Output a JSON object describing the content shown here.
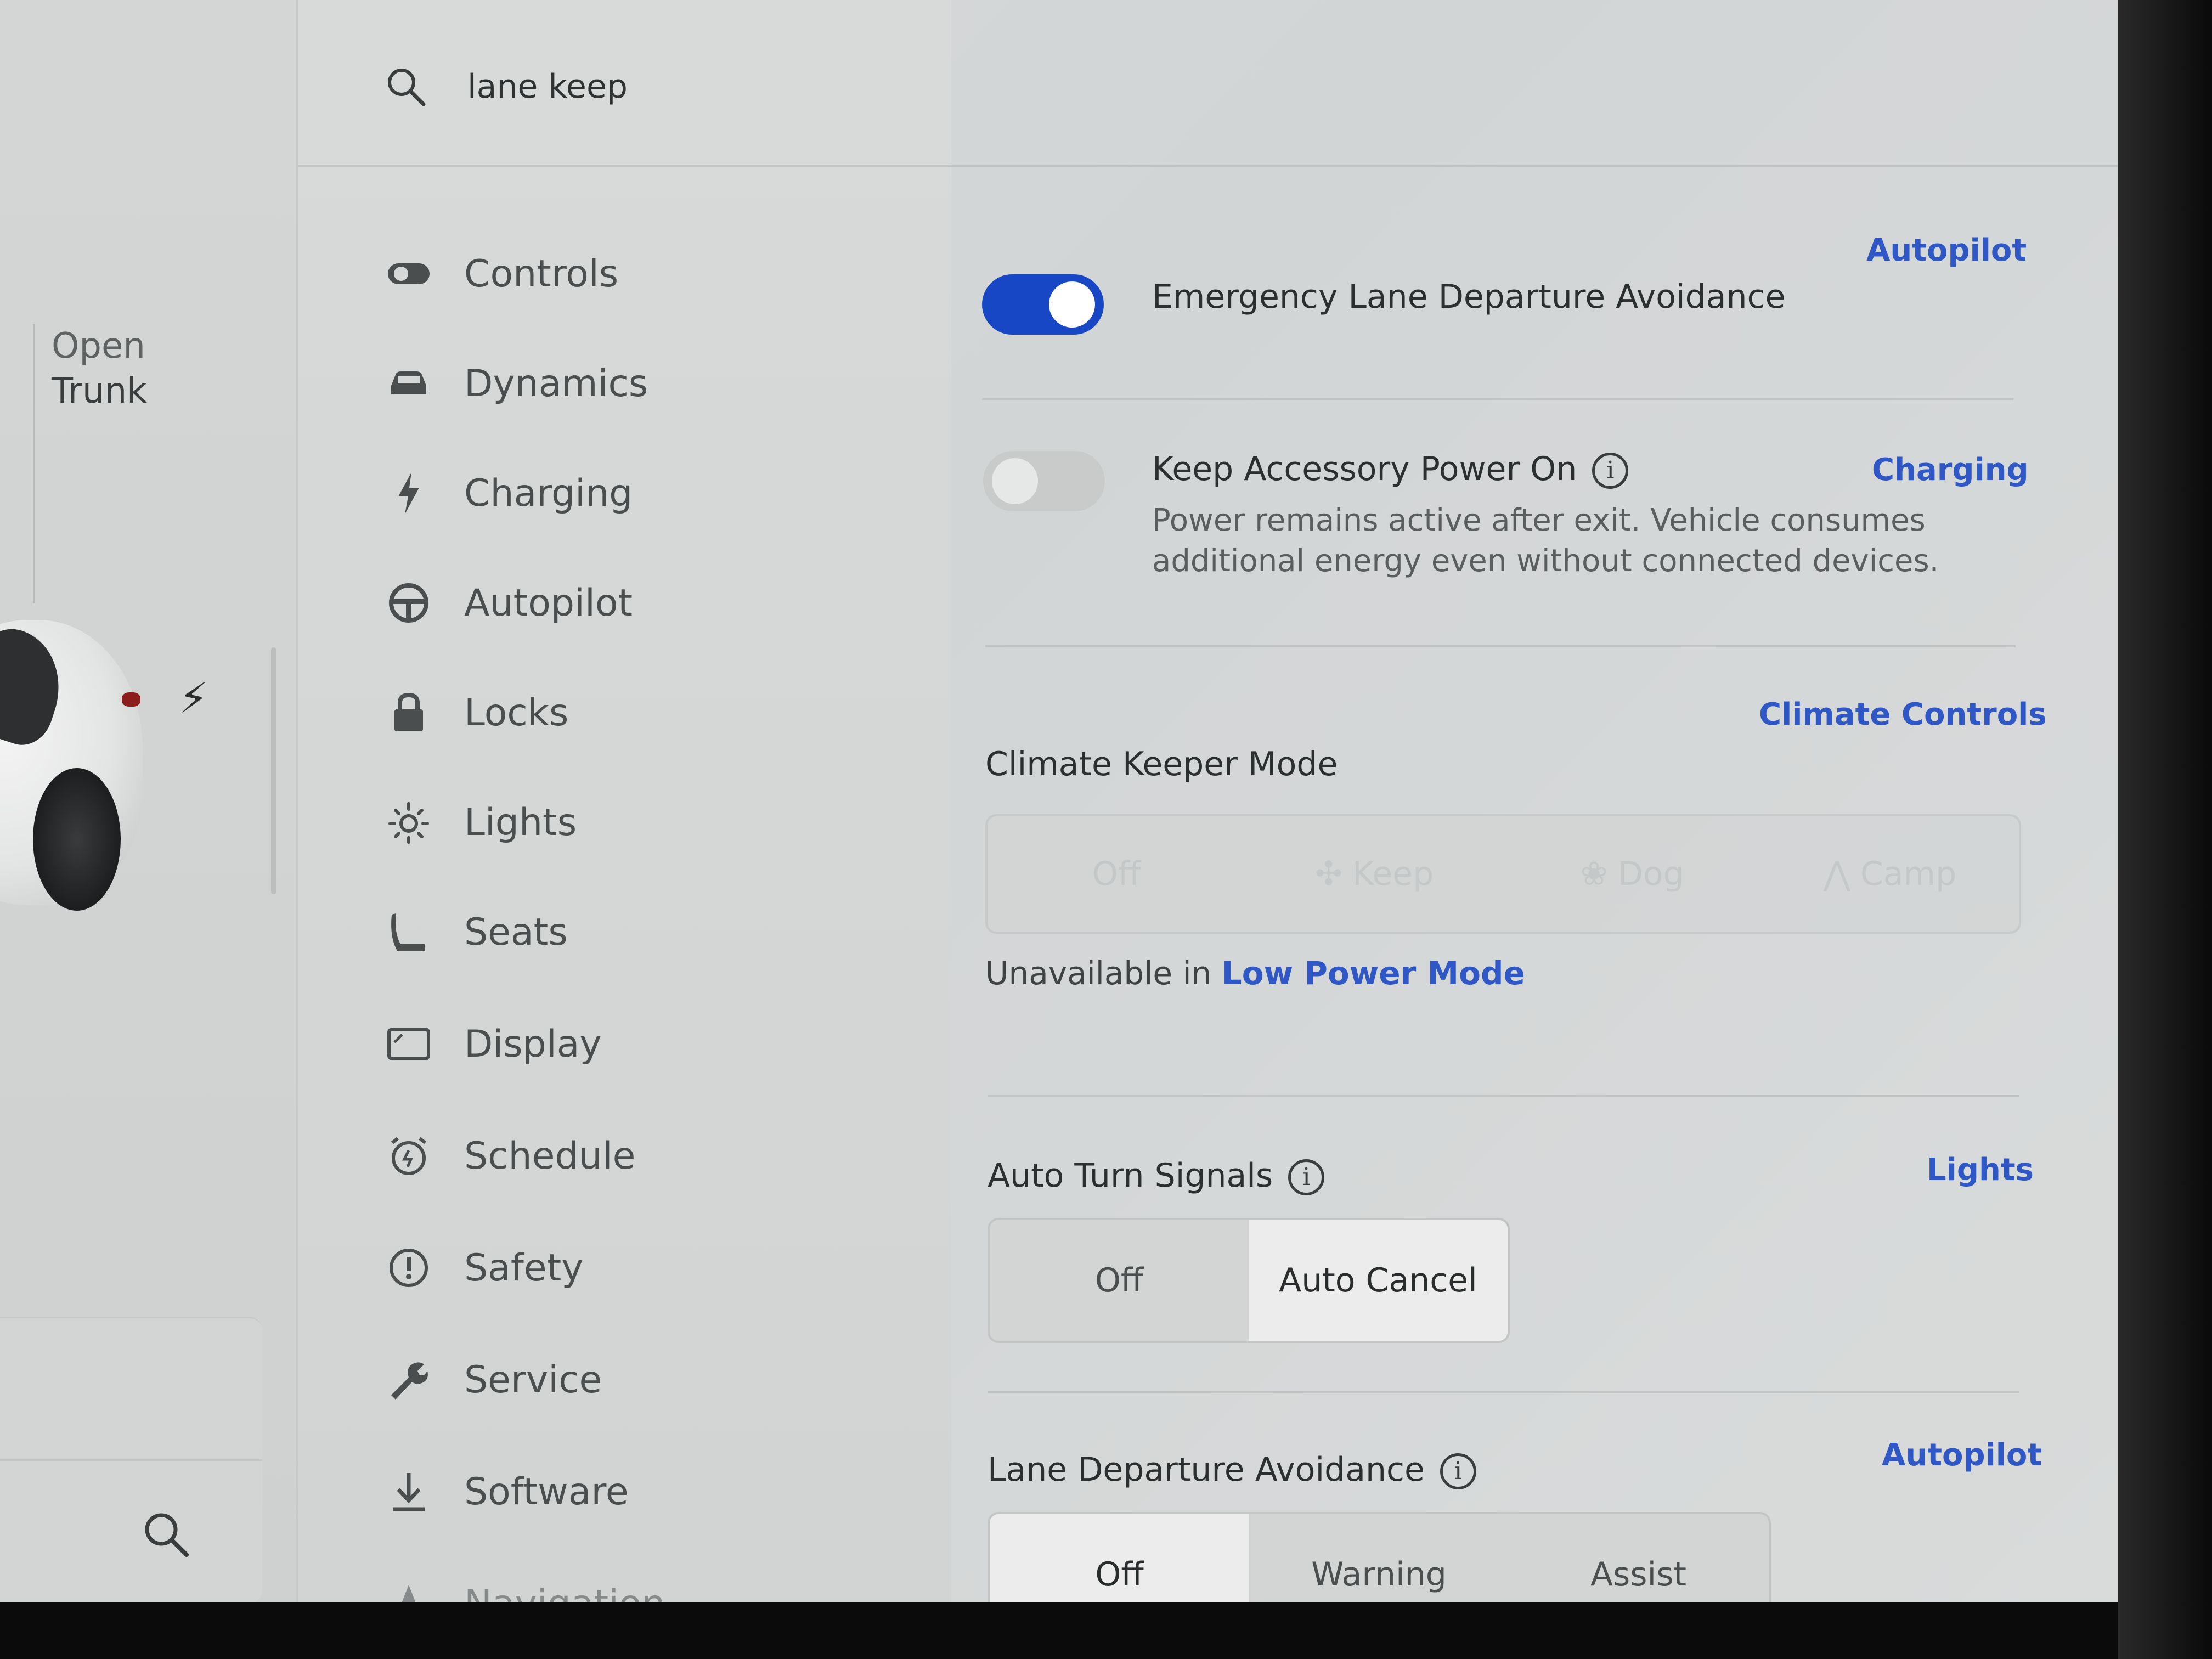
{
  "search": {
    "query": "lane keep"
  },
  "left_panel": {
    "trunk_line1": "Open",
    "trunk_line2": "Trunk"
  },
  "menu": [
    {
      "label": "Controls",
      "icon": "toggle-icon"
    },
    {
      "label": "Dynamics",
      "icon": "car-icon"
    },
    {
      "label": "Charging",
      "icon": "bolt-icon"
    },
    {
      "label": "Autopilot",
      "icon": "steering-wheel-icon"
    },
    {
      "label": "Locks",
      "icon": "lock-icon"
    },
    {
      "label": "Lights",
      "icon": "sun-icon"
    },
    {
      "label": "Seats",
      "icon": "seat-icon"
    },
    {
      "label": "Display",
      "icon": "display-icon"
    },
    {
      "label": "Schedule",
      "icon": "alarm-clock-icon"
    },
    {
      "label": "Safety",
      "icon": "alert-icon"
    },
    {
      "label": "Service",
      "icon": "wrench-icon"
    },
    {
      "label": "Software",
      "icon": "download-icon"
    },
    {
      "label": "Navigation",
      "icon": "navigation-arrow-icon"
    }
  ],
  "results": {
    "elda": {
      "category": "Autopilot",
      "title": "Emergency Lane Departure Avoidance",
      "enabled": true
    },
    "accessory": {
      "category": "Charging",
      "title": "Keep Accessory Power On",
      "description": "Power remains active after exit. Vehicle consumes additional energy even without connected devices.",
      "enabled": false
    },
    "climate": {
      "category": "Climate Controls",
      "title": "Climate Keeper Mode",
      "options": [
        "Off",
        "Keep",
        "Dog",
        "Camp"
      ],
      "unavailable_prefix": "Unavailable in",
      "unavailable_link": "Low Power Mode"
    },
    "turn_signals": {
      "category": "Lights",
      "title": "Auto Turn Signals",
      "options": [
        "Off",
        "Auto Cancel"
      ],
      "selected": "Auto Cancel"
    },
    "lda": {
      "category": "Autopilot",
      "title": "Lane Departure Avoidance",
      "options": [
        "Off",
        "Warning",
        "Assist"
      ],
      "selected": "Off"
    }
  },
  "colors": {
    "accent": "#1747c4",
    "link": "#2f57c6",
    "background": "#d6d8d8"
  }
}
